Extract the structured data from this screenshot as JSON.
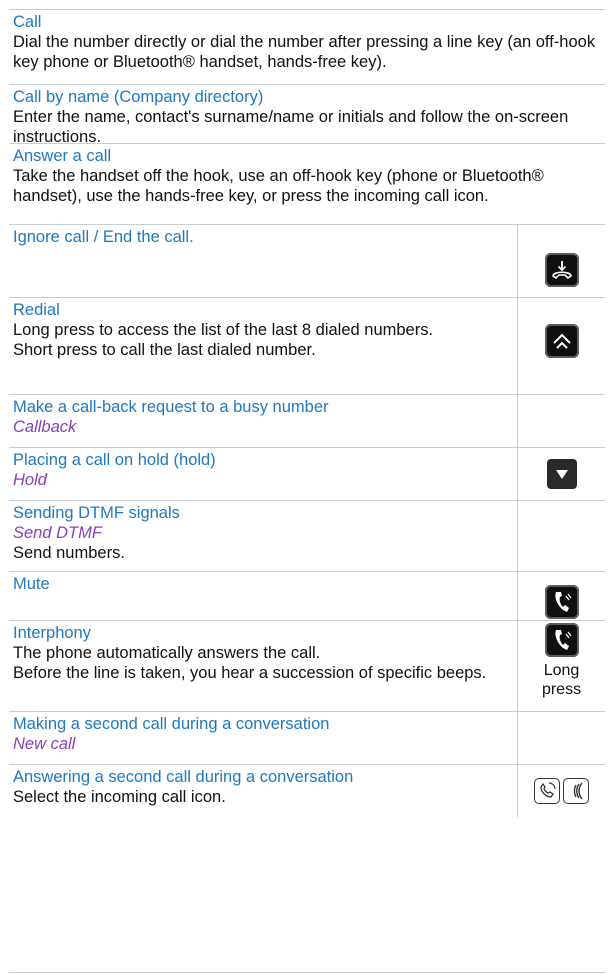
{
  "rows": [
    {
      "title": "Call",
      "desc": "Dial the number directly or dial the number after pressing a line key (an off-hook key phone or Bluetooth® handset, hands-free key)."
    },
    {
      "title": "Call by name (Company directory)",
      "desc": "Enter the name, contact's surname/name or initials and follow the on-screen instructions."
    },
    {
      "title": "Answer a call",
      "desc": "Take the handset off the hook, use an off-hook key (phone or Bluetooth® handset), use the hands-free key, or press the incoming call icon."
    },
    {
      "title": "Ignore call / End the call.",
      "icon": "hang-up-key-icon"
    },
    {
      "title": "Redial",
      "desc": "Long press to access the list of the last 8 dialed numbers.",
      "desc2": "Short press to call the last dialed number.",
      "icon": "redial-key-icon"
    },
    {
      "title": "Make a call-back request to a busy number",
      "action": "Callback"
    },
    {
      "title": "Placing a call on hold (hold)",
      "action": "Hold",
      "icon": "hold-key-icon"
    },
    {
      "title": "Sending DTMF signals",
      "action": "Send DTMF",
      "desc": "Send numbers."
    },
    {
      "title": "Mute",
      "icon": "mute-key-icon"
    },
    {
      "title": "Interphony",
      "desc": "The phone automatically answers the call.",
      "desc2": "Before the line is taken, you hear a succession of specific beeps.",
      "icon": "mute-key-icon",
      "icon_note": "Long press"
    },
    {
      "title": "Making a second call during a conversation",
      "action": "New call"
    },
    {
      "title": "Answering a second call during a conversation",
      "desc": "Select the incoming call icon.",
      "icon": "incoming-call-icons"
    }
  ],
  "colors": {
    "title": "#1f78c1",
    "action": "#8a3fc0",
    "text": "#111111",
    "divider": "#c8ced6"
  }
}
